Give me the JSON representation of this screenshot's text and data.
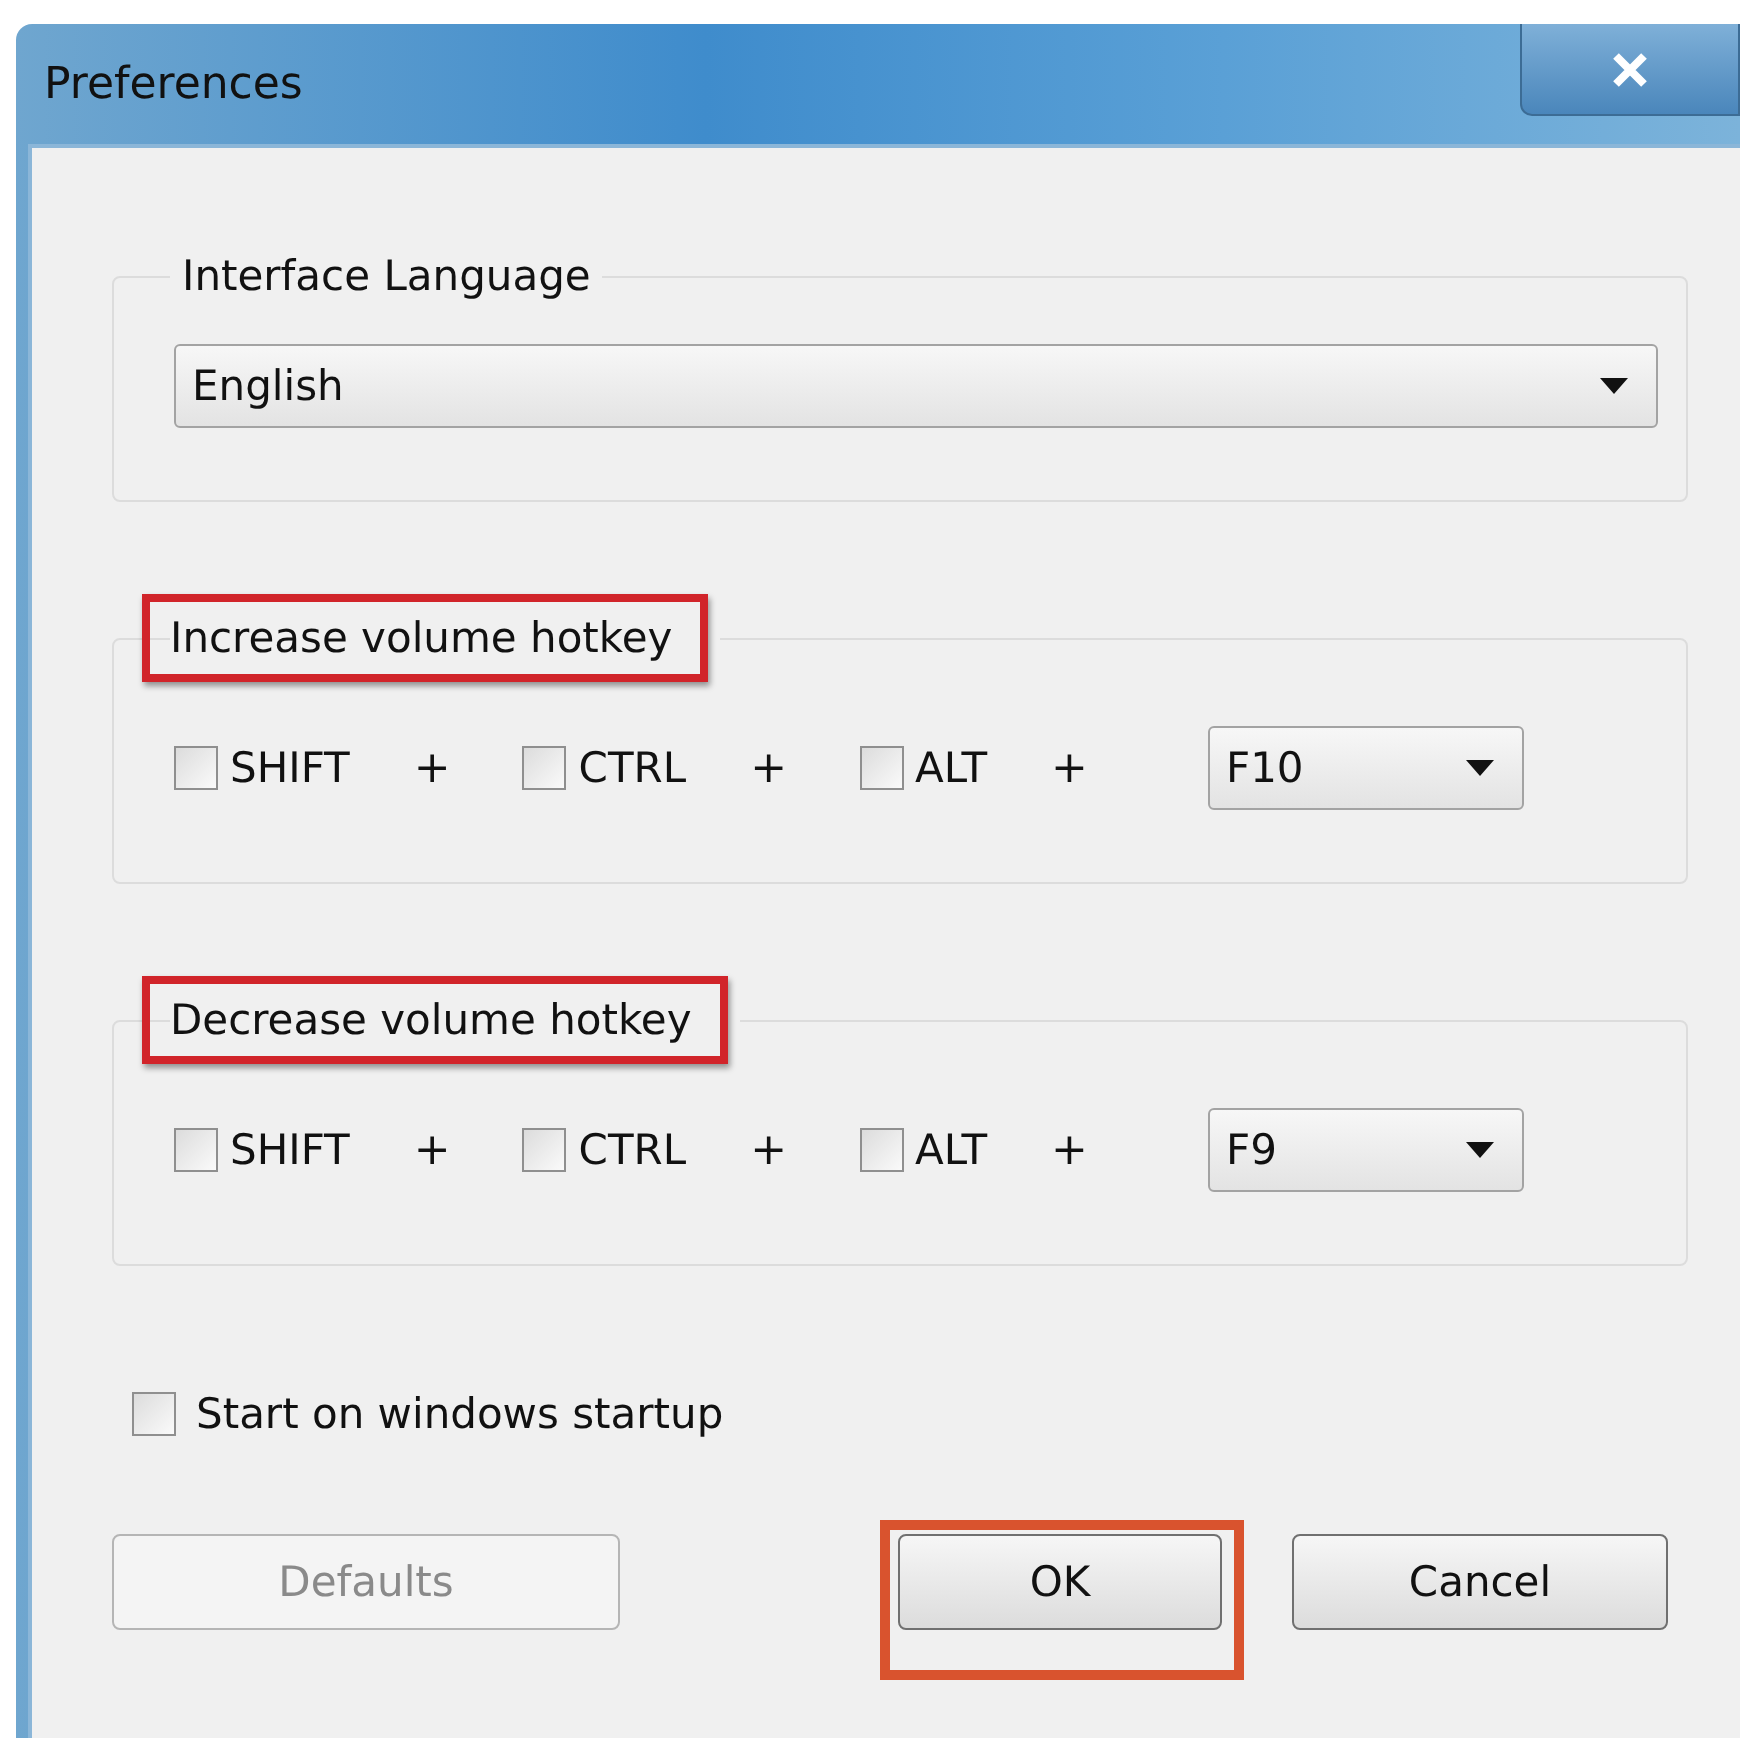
{
  "window": {
    "title": "Preferences"
  },
  "language_group": {
    "label": "Interface Language",
    "dropdown": {
      "value": "English"
    }
  },
  "hotkey_groups": [
    {
      "label": "Increase volume hotkey",
      "highlighted": true,
      "modifiers": [
        {
          "label": "SHIFT",
          "checked": false,
          "joiner": "+"
        },
        {
          "label": "CTRL",
          "checked": false,
          "joiner": "+"
        },
        {
          "label": "ALT",
          "checked": false,
          "joiner": "+"
        }
      ],
      "key": {
        "value": "F10"
      }
    },
    {
      "label": "Decrease volume hotkey",
      "highlighted": true,
      "modifiers": [
        {
          "label": "SHIFT",
          "checked": false,
          "joiner": "+"
        },
        {
          "label": "CTRL",
          "checked": false,
          "joiner": "+"
        },
        {
          "label": "ALT",
          "checked": false,
          "joiner": "+"
        }
      ],
      "key": {
        "value": "F9"
      }
    }
  ],
  "startup": {
    "label": "Start on windows startup",
    "checked": false
  },
  "buttons": [
    {
      "label": "Defaults",
      "disabled": true,
      "highlighted": false
    },
    {
      "label": "OK",
      "disabled": false,
      "highlighted": true
    },
    {
      "label": "Cancel",
      "disabled": false,
      "highlighted": false
    }
  ]
}
